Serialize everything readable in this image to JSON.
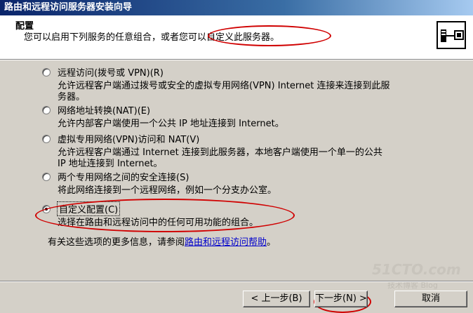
{
  "window": {
    "title": "路由和远程访问服务器安装向导"
  },
  "header": {
    "title": "配置",
    "subtitle": "您可以启用下列服务的任意组合，或者您可以自定义此服务器。",
    "icon": "server-network-icon"
  },
  "options": [
    {
      "label": "远程访问(拨号或 VPN)(R)",
      "desc": "允许远程客户端通过拨号或安全的虚拟专用网络(VPN) Internet 连接来连接到此服\n务器。",
      "checked": false
    },
    {
      "label": "网络地址转换(NAT)(E)",
      "desc": "允许内部客户端使用一个公共 IP 地址连接到 Internet。",
      "checked": false
    },
    {
      "label": "虚拟专用网络(VPN)访问和 NAT(V)",
      "desc": "允许远程客户端通过 Internet 连接到此服务器，本地客户端使用一个单一的公共\nIP 地址连接到 Internet。",
      "checked": false
    },
    {
      "label": "两个专用网络之间的安全连接(S)",
      "desc": "将此网络连接到一个远程网络，例如一个分支办公室。",
      "checked": false
    },
    {
      "label": "自定义配置(C)",
      "desc": "选择在路由和远程访问中的任何可用功能的组合。",
      "checked": true
    }
  ],
  "info": {
    "prefix": "有关这些选项的更多信息，请参阅",
    "link": "路由和远程访问帮助",
    "suffix": "。"
  },
  "buttons": {
    "back": "< 上一步(B)",
    "next": "下一步(N) >",
    "cancel": "取消"
  },
  "watermark": {
    "main": "51CTO.com",
    "sub": "技术博客 Blog"
  },
  "annotation_color": "#d00000"
}
